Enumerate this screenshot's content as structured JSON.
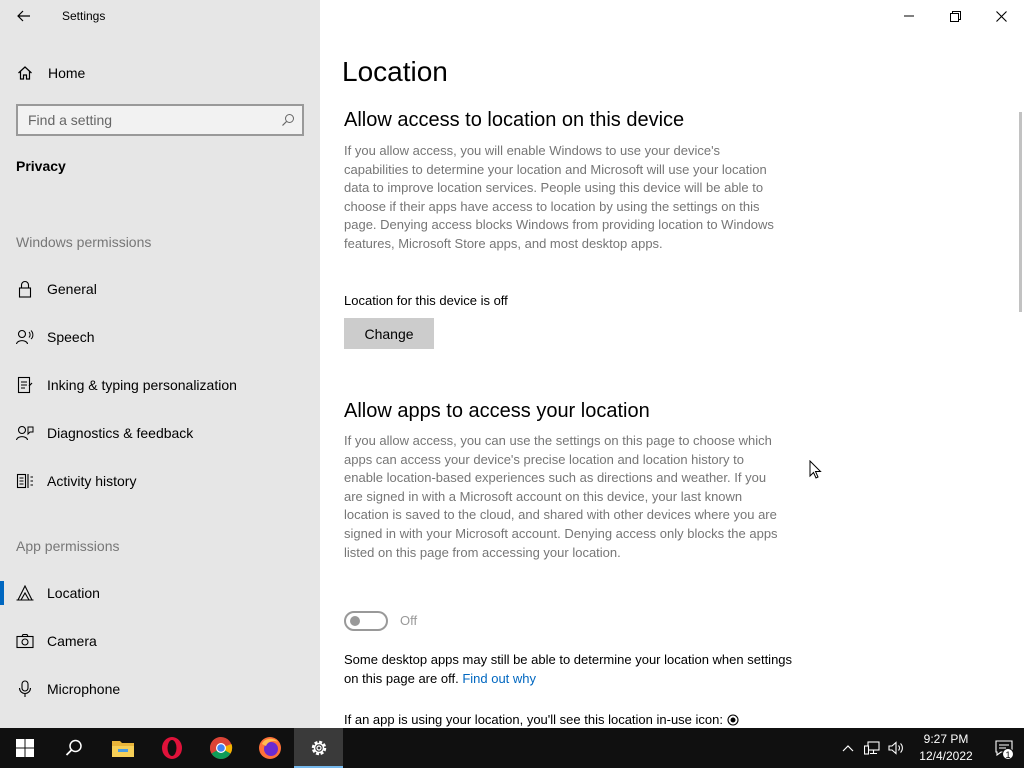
{
  "window": {
    "title": "Settings"
  },
  "sidebar": {
    "home_label": "Home",
    "search_placeholder": "Find a setting",
    "section_title": "Privacy",
    "windows_permissions_label": "Windows permissions",
    "windows_items": [
      {
        "label": "General",
        "icon": "lock-icon"
      },
      {
        "label": "Speech",
        "icon": "speech-icon"
      },
      {
        "label": "Inking & typing personalization",
        "icon": "inking-icon"
      },
      {
        "label": "Diagnostics & feedback",
        "icon": "diagnostics-icon"
      },
      {
        "label": "Activity history",
        "icon": "activity-history-icon"
      }
    ],
    "app_permissions_label": "App permissions",
    "app_items": [
      {
        "label": "Location",
        "icon": "location-icon",
        "selected": true
      },
      {
        "label": "Camera",
        "icon": "camera-icon"
      },
      {
        "label": "Microphone",
        "icon": "microphone-icon"
      }
    ]
  },
  "main": {
    "page_title": "Location",
    "device_section": {
      "heading": "Allow access to location on this device",
      "description": "If you allow access, you will enable Windows to use your device's capabilities to determine your location and Microsoft will use your location data to improve location services. People using this device will be able to choose if their apps have access to location by using the settings on this page. Denying access blocks Windows from providing location to Windows features, Microsoft Store apps, and most desktop apps.",
      "status": "Location for this device is off",
      "change_label": "Change"
    },
    "apps_section": {
      "heading": "Allow apps to access your location",
      "description": "If you allow access, you can use the settings on this page to choose which apps can access your device's precise location and location history to enable location-based experiences such as directions and weather. If you are signed in with a Microsoft account on this device, your last known location is saved to the cloud, and shared with other devices where you are signed in with your Microsoft account. Denying access only blocks the apps listed on this page from accessing your location.",
      "toggle_state": "Off",
      "note": "Some desktop apps may still be able to determine your location when settings on this page are off.",
      "note_link": "Find out why",
      "inuse_text": "If an app is using your location, you'll see this location in-use icon:"
    }
  },
  "taskbar": {
    "apps": [
      "start-icon",
      "search-icon",
      "file-explorer-icon",
      "opera-icon",
      "chrome-icon",
      "firefox-icon",
      "settings-icon"
    ],
    "time": "9:27 PM",
    "date": "12/4/2022",
    "notification_count": "1"
  },
  "colors": {
    "accent": "#0067c0",
    "sidebar_bg": "#e6e6e6",
    "taskbar_bg": "#101010"
  }
}
